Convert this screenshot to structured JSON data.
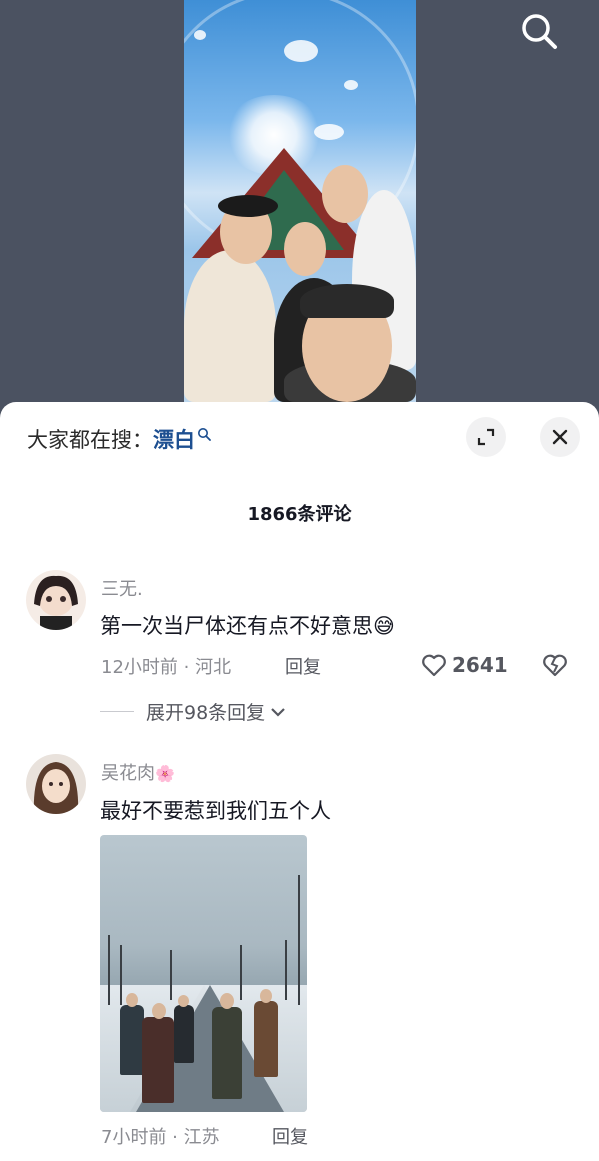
{
  "header": {
    "search_icon": "search-icon"
  },
  "panel": {
    "search_prefix": "大家都在搜：",
    "search_term": "漂白",
    "expand_icon": "expand-icon",
    "close_icon": "close-icon",
    "comment_count": "1866条评论"
  },
  "comments": [
    {
      "username": "三无.",
      "text": "第一次当尸体还有点不好意思",
      "emoji": "😅",
      "time_location": "12小时前 · 河北",
      "reply_label": "回复",
      "likes": "2641",
      "expand_label": "展开98条回复"
    },
    {
      "username": "吴花肉",
      "username_badge": "🌸",
      "text": "最好不要惹到我们五个人",
      "time_location": "7小时前 · 江苏",
      "reply_label": "回复"
    }
  ],
  "colors": {
    "accent_search_term": "#1d4f91",
    "panel_bg": "#ffffff",
    "video_bg": "#4b5261"
  }
}
